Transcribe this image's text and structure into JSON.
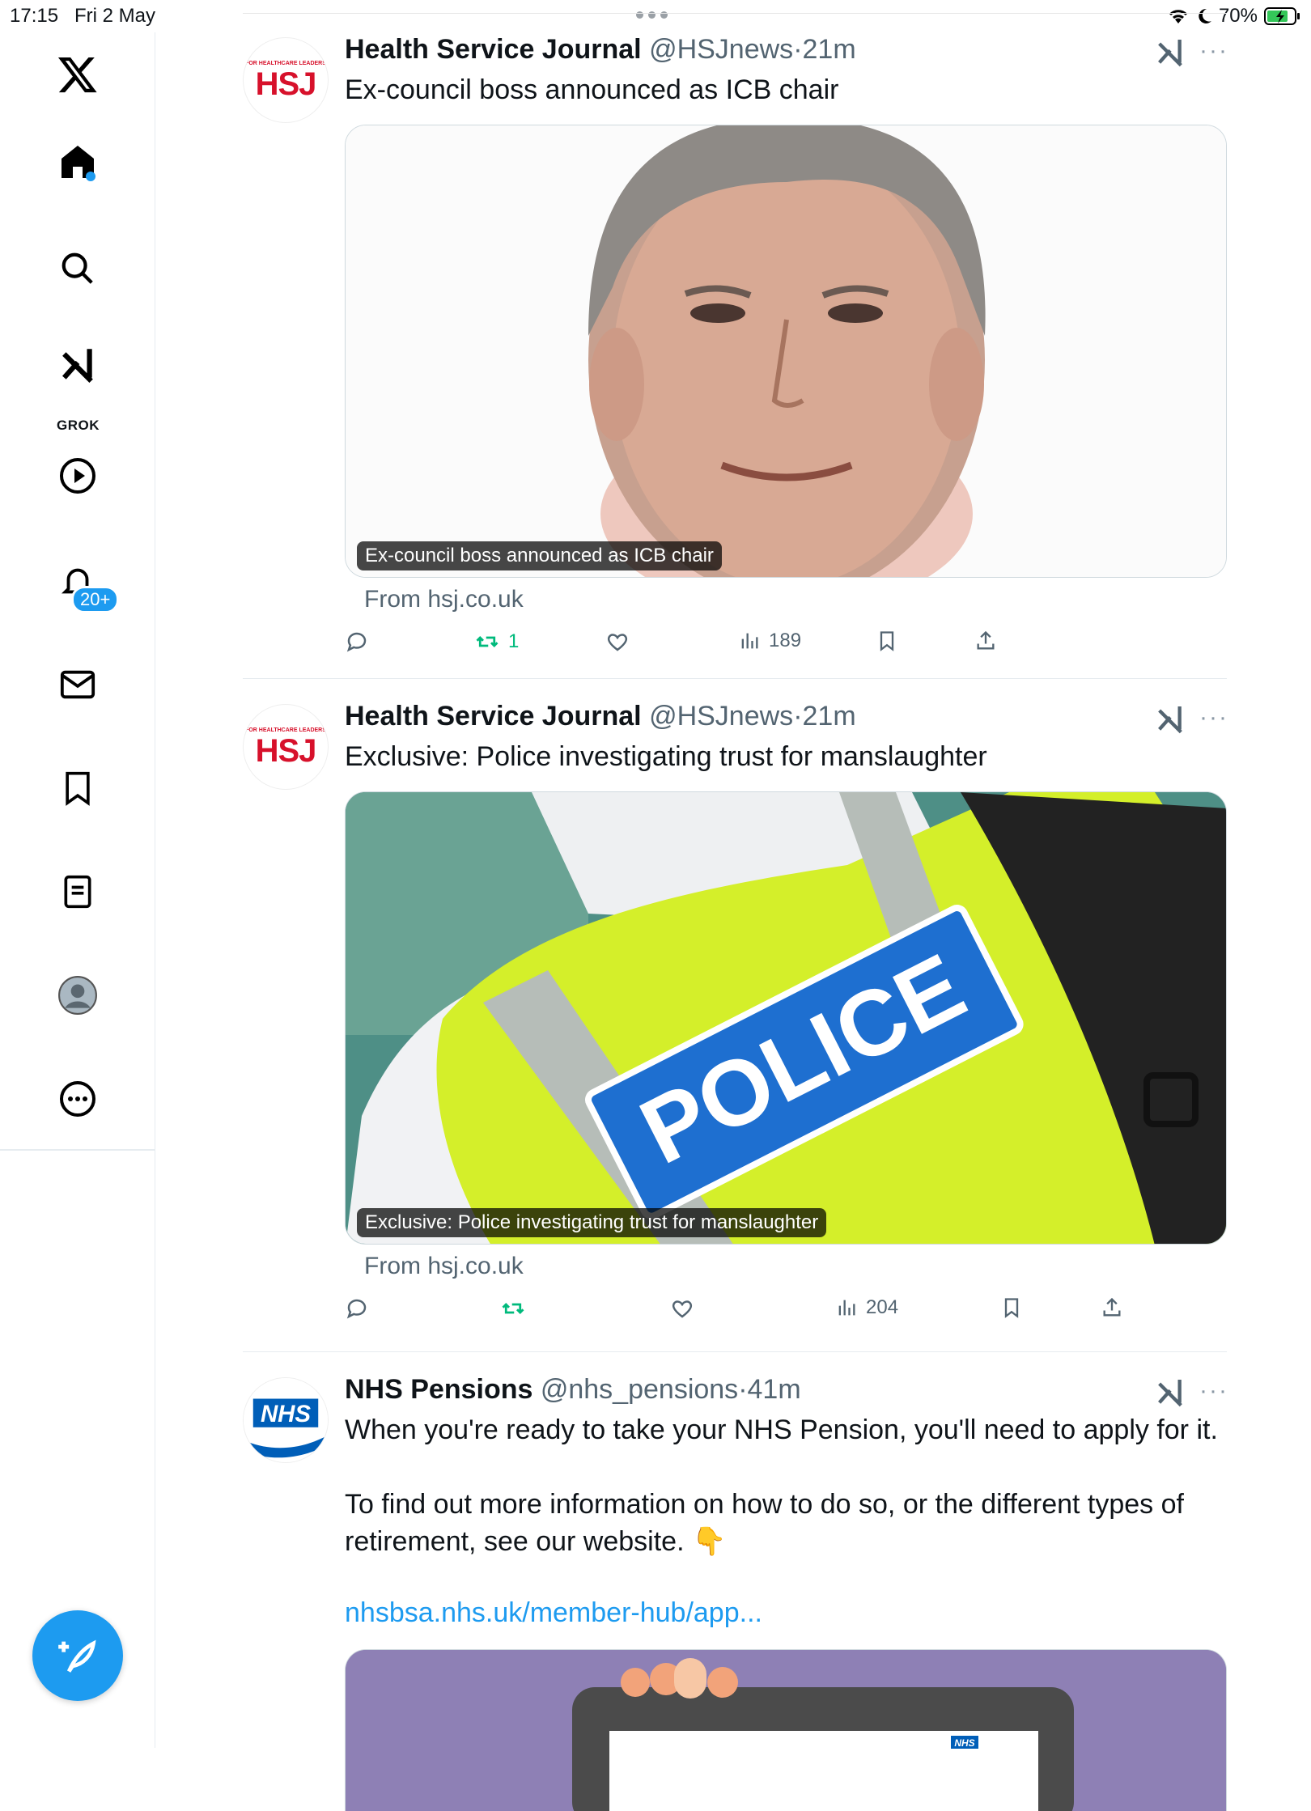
{
  "status": {
    "time": "17:15",
    "date": "Fri 2 May",
    "battery": "70%"
  },
  "sidebar": {
    "grok_label": "GROK",
    "notifications_badge": "20+"
  },
  "tweets": [
    {
      "name": "Health Service Journal",
      "handle": "@HSJnews",
      "dot": "·",
      "time": "21m",
      "text": "Ex-council boss announced as ICB chair",
      "card_overlay": "Ex-council boss announced as ICB chair",
      "from": "From hsj.co.uk",
      "retweets": "1",
      "views": "189",
      "avatar_text": "HSJ",
      "avatar_small": "FOR HEALTHCARE LEADERS"
    },
    {
      "name": "Health Service Journal",
      "handle": "@HSJnews",
      "dot": "·",
      "time": "21m",
      "text": "Exclusive: Police investigating trust for manslaughter",
      "card_overlay": "Exclusive: Police investigating trust for manslaughter",
      "image_text": "POLICE",
      "from": "From hsj.co.uk",
      "views": "204",
      "avatar_text": "HSJ",
      "avatar_small": "FOR HEALTHCARE LEADERS"
    },
    {
      "name": "NHS Pensions",
      "handle": "@nhs_pensions",
      "dot": "·",
      "time": "41m",
      "line1": "When you're ready to take your NHS Pension, you'll need to apply for it.",
      "line2": "To find out more information on how to do so, or the different types of",
      "line3": "retirement, see our website. 👇",
      "link": "nhsbsa.nhs.uk/member-hub/app...",
      "avatar_text": "NHS",
      "card_logo": "NHS"
    }
  ],
  "colors": {
    "accent": "#1d9bf0",
    "retweet": "#00ba7c",
    "hsj_red": "#d7112b",
    "nhs_blue": "#005eb8",
    "card_purple": "#8e80b5"
  }
}
